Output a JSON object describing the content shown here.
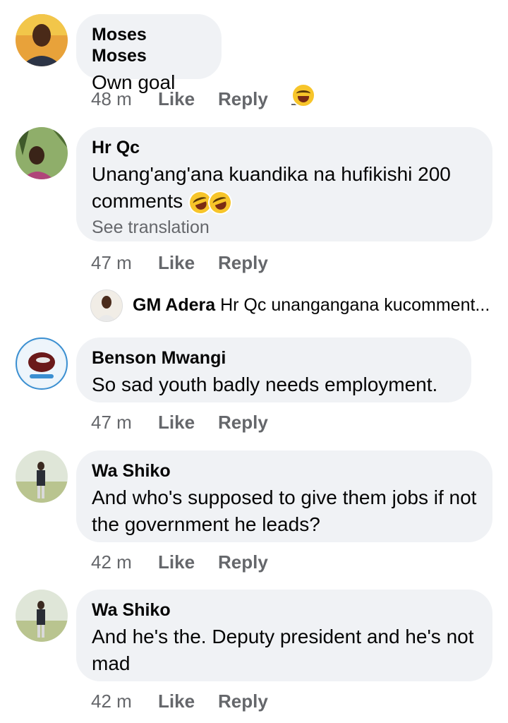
{
  "comments": [
    {
      "author": "Moses Moses",
      "text": "Own goal",
      "time": "48 m",
      "like": "Like",
      "reply": "Reply",
      "reaction_count": "1",
      "reaction_icon": "laugh-emoji-icon"
    },
    {
      "author": "Hr Qc",
      "text": "Unang'ang'ana kuandika na hufikishi 200 comments",
      "emojis": [
        "rolling-laughing-emoji-icon",
        "rolling-laughing-emoji-icon"
      ],
      "see_translation": "See translation",
      "time": "47 m",
      "like": "Like",
      "reply": "Reply"
    },
    {
      "author": "Benson Mwangi",
      "text": "So sad youth badly needs employment.",
      "time": "47 m",
      "like": "Like",
      "reply": "Reply"
    },
    {
      "author": "Wa Shiko",
      "text": "And who's supposed to give them jobs if not the government he leads?",
      "time": "42 m",
      "like": "Like",
      "reply": "Reply"
    },
    {
      "author": "Wa Shiko",
      "text": "And he's the. Deputy president and he's not mad",
      "time": "42 m",
      "like": "Like",
      "reply": "Reply"
    }
  ],
  "reply_preview": {
    "author": "GM Adera",
    "text": "Hr Qc unangangana kucomment..."
  },
  "colors": {
    "bubble": "#f0f2f5",
    "secondary_text": "#65676b",
    "primary_text": "#050505"
  }
}
